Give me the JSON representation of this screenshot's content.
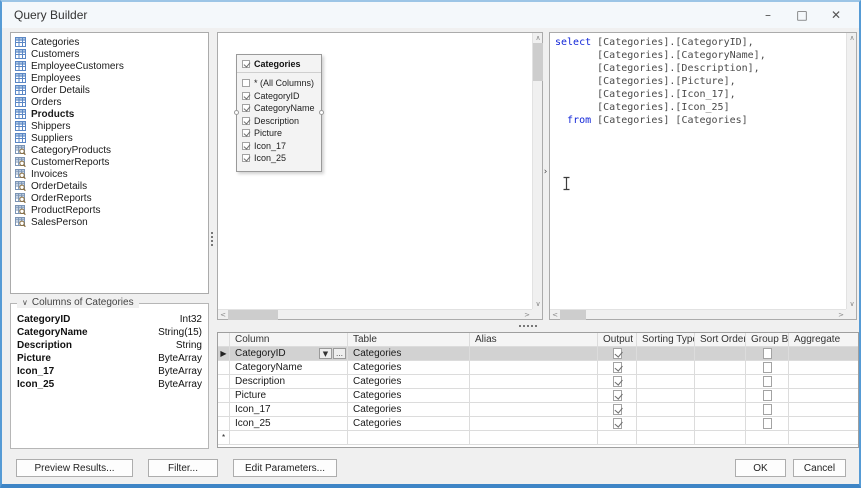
{
  "window": {
    "title": "Query Builder",
    "controls": {
      "minimize": "–",
      "maximize": "□",
      "close": "✕"
    }
  },
  "colors": {
    "accent_border": "#3e85c6",
    "sql_keyword": "#1226d8",
    "selection": "#d2d2d2"
  },
  "tables_list": {
    "items": [
      {
        "label": "Categories",
        "icon": "table",
        "bold": false
      },
      {
        "label": "Customers",
        "icon": "table",
        "bold": false
      },
      {
        "label": "EmployeeCustomers",
        "icon": "table",
        "bold": false
      },
      {
        "label": "Employees",
        "icon": "table",
        "bold": false
      },
      {
        "label": "Order Details",
        "icon": "table",
        "bold": false
      },
      {
        "label": "Orders",
        "icon": "table",
        "bold": false
      },
      {
        "label": "Products",
        "icon": "table",
        "bold": true
      },
      {
        "label": "Shippers",
        "icon": "table",
        "bold": false
      },
      {
        "label": "Suppliers",
        "icon": "table",
        "bold": false
      },
      {
        "label": "CategoryProducts",
        "icon": "view",
        "bold": false
      },
      {
        "label": "CustomerReports",
        "icon": "view",
        "bold": false
      },
      {
        "label": "Invoices",
        "icon": "view",
        "bold": false
      },
      {
        "label": "OrderDetails",
        "icon": "view",
        "bold": false
      },
      {
        "label": "OrderReports",
        "icon": "view",
        "bold": false
      },
      {
        "label": "ProductReports",
        "icon": "view",
        "bold": false
      },
      {
        "label": "SalesPerson",
        "icon": "view",
        "bold": false
      }
    ]
  },
  "columns_panel": {
    "title": "Columns of Categories",
    "columns": [
      {
        "name": "CategoryID",
        "type": "Int32"
      },
      {
        "name": "CategoryName",
        "type": "String(15)"
      },
      {
        "name": "Description",
        "type": "String"
      },
      {
        "name": "Picture",
        "type": "ByteArray"
      },
      {
        "name": "Icon_17",
        "type": "ByteArray"
      },
      {
        "name": "Icon_25",
        "type": "ByteArray"
      }
    ]
  },
  "diagram": {
    "table": {
      "name": "Categories",
      "checked": true,
      "fields": [
        {
          "label": "* (All Columns)",
          "checked": false
        },
        {
          "label": "CategoryID",
          "checked": true
        },
        {
          "label": "CategoryName",
          "checked": true
        },
        {
          "label": "Description",
          "checked": true
        },
        {
          "label": "Picture",
          "checked": true
        },
        {
          "label": "Icon_17",
          "checked": true
        },
        {
          "label": "Icon_25",
          "checked": true
        }
      ]
    }
  },
  "sql": {
    "lines": [
      [
        {
          "t": "select",
          "k": true
        },
        {
          "t": " [Categories].[CategoryID],",
          "k": false
        }
      ],
      [
        {
          "t": "       [Categories].[CategoryName],",
          "k": false
        }
      ],
      [
        {
          "t": "       [Categories].[Description],",
          "k": false
        }
      ],
      [
        {
          "t": "       [Categories].[Picture],",
          "k": false
        }
      ],
      [
        {
          "t": "       [Categories].[Icon_17],",
          "k": false
        }
      ],
      [
        {
          "t": "       [Categories].[Icon_25]",
          "k": false
        }
      ],
      [
        {
          "t": "  ",
          "k": false
        },
        {
          "t": "from",
          "k": true
        },
        {
          "t": " [Categories] [Categories]",
          "k": false
        }
      ]
    ]
  },
  "grid": {
    "headers": [
      "Column",
      "Table",
      "Alias",
      "Output",
      "Sorting Type",
      "Sort Order",
      "Group By",
      "Aggregate"
    ],
    "selected_row_indicator": "▶",
    "new_row_indicator": "*",
    "rows": [
      {
        "column": "CategoryID",
        "table": "Categories",
        "alias": "",
        "output": true,
        "sorting_type": "",
        "sort_order": "",
        "group_by": false,
        "aggregate": "",
        "selected": true
      },
      {
        "column": "CategoryName",
        "table": "Categories",
        "alias": "",
        "output": true,
        "sorting_type": "",
        "sort_order": "",
        "group_by": false,
        "aggregate": "",
        "selected": false
      },
      {
        "column": "Description",
        "table": "Categories",
        "alias": "",
        "output": true,
        "sorting_type": "",
        "sort_order": "",
        "group_by": false,
        "aggregate": "",
        "selected": false
      },
      {
        "column": "Picture",
        "table": "Categories",
        "alias": "",
        "output": true,
        "sorting_type": "",
        "sort_order": "",
        "group_by": false,
        "aggregate": "",
        "selected": false
      },
      {
        "column": "Icon_17",
        "table": "Categories",
        "alias": "",
        "output": true,
        "sorting_type": "",
        "sort_order": "",
        "group_by": false,
        "aggregate": "",
        "selected": false
      },
      {
        "column": "Icon_25",
        "table": "Categories",
        "alias": "",
        "output": true,
        "sorting_type": "",
        "sort_order": "",
        "group_by": false,
        "aggregate": "",
        "selected": false
      }
    ]
  },
  "footer": {
    "preview_button": "Preview Results...",
    "filter_button": "Filter...",
    "edit_parameters_button": "Edit Parameters...",
    "ok_button": "OK",
    "cancel_button": "Cancel"
  }
}
